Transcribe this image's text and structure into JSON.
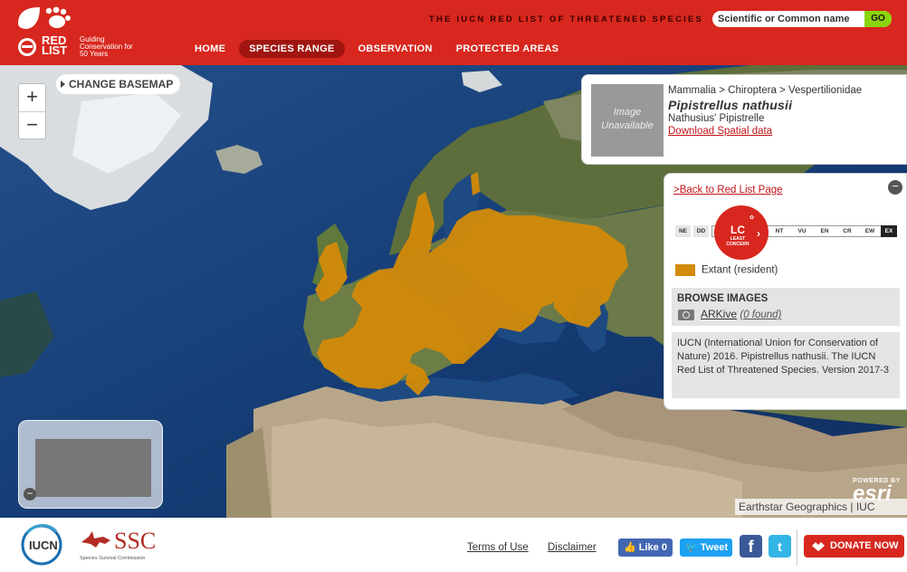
{
  "header": {
    "logo_text": "RED LIST",
    "logo_tagline": "Guiding Conservation for 50 Years",
    "tagline": "THE IUCN RED LIST OF THREATENED SPECIES",
    "search_placeholder": "Scientific or Common name",
    "search_button": "GO",
    "nav": [
      {
        "label": "HOME",
        "active": false
      },
      {
        "label": "SPECIES RANGE",
        "active": true
      },
      {
        "label": "OBSERVATION",
        "active": false
      },
      {
        "label": "PROTECTED AREAS",
        "active": false
      }
    ]
  },
  "map": {
    "zoom_in": "+",
    "zoom_out": "−",
    "basemap_button": "CHANGE BASEMAP",
    "range_color": "#d28a0a",
    "esri_powered": "POWERED BY",
    "esri_logo": "esri",
    "attribution": "Earthstar Geographics | IUC"
  },
  "species": {
    "image_placeholder": "Image Unavailable",
    "taxonomy": "Mammalia > Chiroptera > Vespertilionidae",
    "scientific_name": "Pipistrellus nathusii",
    "common_name": "Nathusius' Pipistrelle",
    "download_link": "Download Spatial data"
  },
  "info": {
    "back_link": ">Back to Red List Page",
    "categories": [
      "NE",
      "DD",
      "NT",
      "VU",
      "EN",
      "CR",
      "EW",
      "EX"
    ],
    "status_code": "LC",
    "status_label_1": "LEAST",
    "status_label_2": "CONCERN",
    "legend_label": "Extant (resident)",
    "browse_title": "BROWSE IMAGES",
    "arkive_name": "ARKive",
    "arkive_count": "(0 found)",
    "citation": "IUCN (International Union for Conservation of Nature) 2016. Pipistrellus nathusii. The IUCN Red List of Threatened Species. Version 2017-3"
  },
  "footer": {
    "iucn_label": "IUCN",
    "ssc_label": "SSC",
    "ssc_sub": "Species Survival Commission",
    "terms": "Terms of Use",
    "disclaimer": "Disclaimer",
    "fb_like": "Like 0",
    "tweet": "Tweet",
    "donate": "DONATE NOW"
  },
  "colors": {
    "brand_red": "#d7271e",
    "nav_active": "#a01510",
    "go_green": "#8bd40d"
  }
}
